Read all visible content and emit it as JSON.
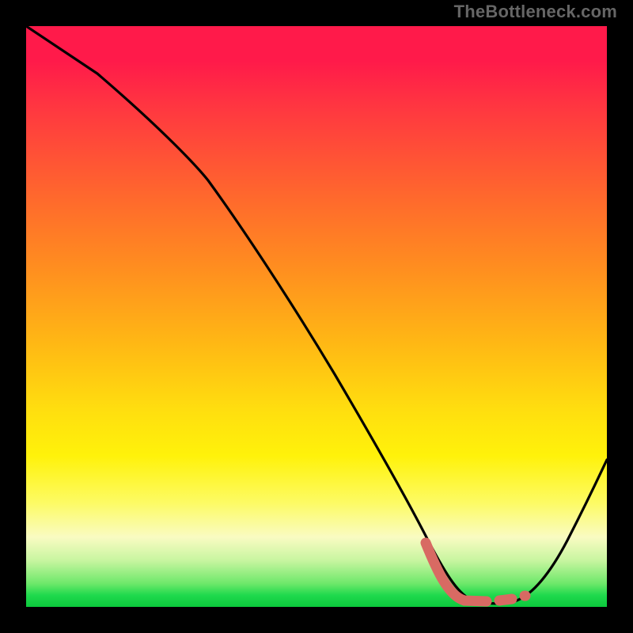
{
  "watermark": "TheBottleneck.com",
  "chart_data": {
    "type": "line",
    "title": "",
    "xlabel": "",
    "ylabel": "",
    "xlim": [
      0,
      100
    ],
    "ylim": [
      0,
      100
    ],
    "series": [
      {
        "name": "main-curve",
        "x": [
          0,
          10,
          20,
          30,
          40,
          50,
          57,
          62,
          66,
          69,
          73,
          77,
          81,
          84,
          88,
          92,
          96,
          100
        ],
        "y": [
          100,
          92,
          85,
          73,
          60,
          48,
          38,
          30,
          23,
          16,
          8,
          2,
          0,
          0,
          2,
          7,
          14,
          22
        ]
      },
      {
        "name": "highlight-segment",
        "x": [
          69,
          70.5,
          72,
          74,
          76,
          77.5,
          80,
          82,
          83.5
        ],
        "y": [
          8,
          5,
          3,
          1.5,
          1,
          1,
          1,
          1.2,
          1.5
        ]
      }
    ],
    "annotations": [],
    "legend": [],
    "colors": {
      "curve": "#000000",
      "highlight": "#d86a63",
      "gradient_top": "#ff1a4a",
      "gradient_bottom": "#0cc93c"
    }
  }
}
